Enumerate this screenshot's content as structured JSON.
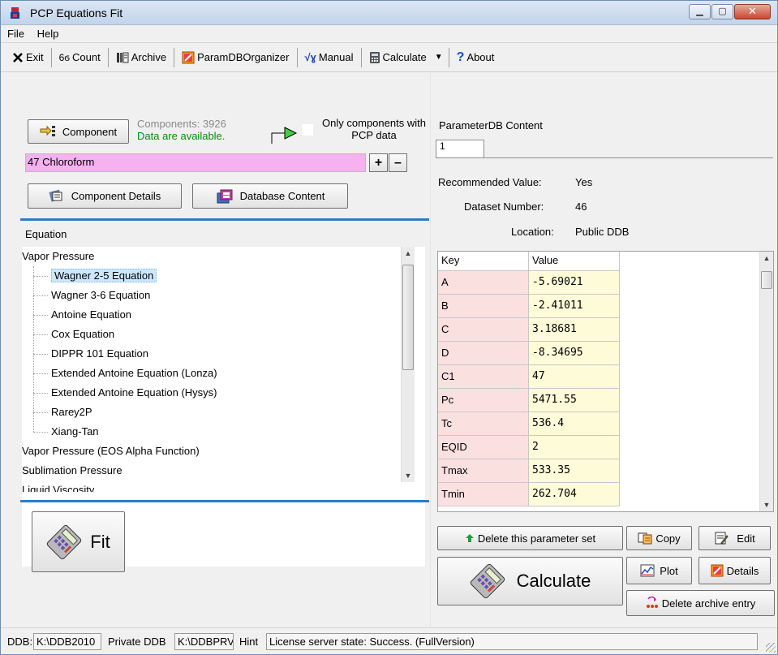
{
  "window": {
    "title": "PCP Equations Fit",
    "minimize_glyph": "▁",
    "maximize_glyph": "▢",
    "close_glyph": "✕"
  },
  "menu": {
    "items": [
      "File",
      "Help"
    ]
  },
  "toolbar": {
    "exit": "Exit",
    "count": "Count",
    "archive": "Archive",
    "paramdb": "ParamDBOrganizer",
    "manual": "Manual",
    "calculate": "Calculate",
    "dropdown_glyph": "▼",
    "about": "About"
  },
  "component": {
    "button_label": "Component",
    "count_text": "Components: 3926",
    "status_text": "Data are available.",
    "only_label": "Only components with PCP data",
    "selected": "47 Chloroform",
    "plus": "+",
    "minus": "–",
    "details_button": "Component Details",
    "dbcontent_button": "Database Content"
  },
  "equation": {
    "header": "Equation",
    "groups": [
      {
        "label": "Vapor Pressure",
        "children": [
          "Wagner 2-5 Equation",
          "Wagner 3-6 Equation",
          "Antoine Equation",
          "Cox Equation",
          "DIPPR 101 Equation",
          "Extended Antoine Equation (Lonza)",
          "Extended Antoine Equation (Hysys)",
          "Rarey2P",
          "Xiang-Tan"
        ]
      },
      {
        "label": "Vapor Pressure (EOS Alpha Function)"
      },
      {
        "label": "Sublimation Pressure"
      },
      {
        "label": "Liquid Viscosity"
      }
    ],
    "selected": "Wagner 2-5 Equation"
  },
  "fit_button": "Fit",
  "parameterdb": {
    "title": "ParameterDB Content",
    "tab": "1",
    "recommended_label": "Recommended Value:",
    "recommended_value": "Yes",
    "dataset_label": "Dataset Number:",
    "dataset_value": "46",
    "location_label": "Location:",
    "location_value": "Public DDB",
    "columns": [
      "Key",
      "Value"
    ],
    "rows": [
      [
        "A",
        "-5.69021"
      ],
      [
        "B",
        "-2.41011"
      ],
      [
        "C",
        "3.18681"
      ],
      [
        "D",
        "-8.34695"
      ],
      [
        "C1",
        "47"
      ],
      [
        "Pc",
        "5471.55"
      ],
      [
        "Tc",
        "536.4"
      ],
      [
        "EQID",
        "2"
      ],
      [
        "Tmax",
        "533.35"
      ],
      [
        "Tmin",
        "262.704"
      ]
    ]
  },
  "actions": {
    "delete_set": "Delete this parameter set",
    "copy": "Copy",
    "edit": "Edit",
    "calculate": "Calculate",
    "plot": "Plot",
    "details": "Details",
    "delete_archive": "Delete archive entry"
  },
  "statusbar": {
    "ddb_label": "DDB:",
    "ddb_value": "K:\\DDB2010",
    "private_label": "Private DDB",
    "private_value": "K:\\DDBPRV",
    "hint_label": "Hint",
    "hint_value": "License server state: Success. (FullVersion)"
  }
}
